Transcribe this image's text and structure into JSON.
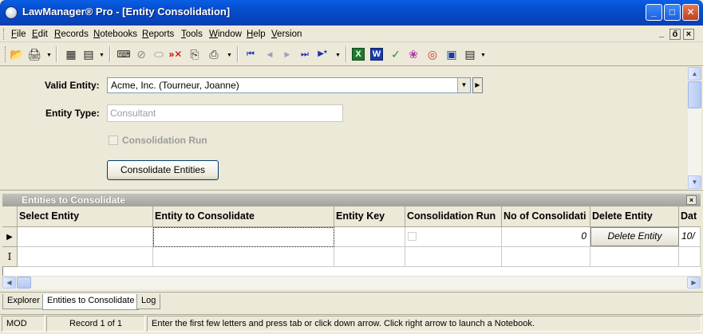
{
  "window": {
    "title": "LawManager® Pro - [Entity Consolidation]",
    "minimize_glyph": "_",
    "maximize_glyph": "□",
    "close_glyph": "✕"
  },
  "menu": {
    "items": [
      "File",
      "Edit",
      "Records",
      "Notebooks",
      "Reports",
      "Tools",
      "Window",
      "Help",
      "Version"
    ],
    "mdi_minimize": "_",
    "mdi_restore": "ő",
    "mdi_close": "×"
  },
  "toolbar": {
    "icons": [
      {
        "name": "open-folder-icon",
        "glyph": "📂"
      },
      {
        "name": "print-icon",
        "glyph": "🖨"
      },
      {
        "name": "window-layout-icon",
        "glyph": "▦"
      },
      {
        "name": "window-tile-icon",
        "glyph": "▤"
      },
      {
        "name": "find-binoculars-icon",
        "glyph": "⌨"
      },
      {
        "name": "cancel-icon",
        "glyph": "⊘"
      },
      {
        "name": "erase-icon",
        "glyph": "⬭"
      },
      {
        "name": "delete-record-icon",
        "glyph": "»✕"
      },
      {
        "name": "copy-record-icon",
        "glyph": "⎘"
      },
      {
        "name": "paste-record-icon",
        "glyph": "⎙"
      },
      {
        "name": "first-record-icon",
        "glyph": "⏮"
      },
      {
        "name": "previous-record-icon",
        "glyph": "◀"
      },
      {
        "name": "next-record-icon",
        "glyph": "▶"
      },
      {
        "name": "last-record-icon",
        "glyph": "⏭"
      },
      {
        "name": "new-record-icon",
        "glyph": "▶*"
      },
      {
        "name": "excel-icon",
        "glyph": "X"
      },
      {
        "name": "word-icon",
        "glyph": "W"
      },
      {
        "name": "spell-check-icon",
        "glyph": "✓"
      },
      {
        "name": "palette-icon",
        "glyph": "❀"
      },
      {
        "name": "help-lifebuoy-icon",
        "glyph": "◎"
      },
      {
        "name": "reports-icon",
        "glyph": "▣"
      },
      {
        "name": "form-view-icon",
        "glyph": "▤"
      }
    ]
  },
  "form": {
    "valid_entity_label": "Valid Entity:",
    "valid_entity_value": "Acme, Inc. (Tourneur, Joanne)",
    "entity_type_label": "Entity Type:",
    "entity_type_value": "Consultant",
    "consolidation_run_label": "Consolidation Run",
    "consolidate_button": "Consolidate Entities"
  },
  "grid": {
    "title": "Entities to Consolidate",
    "columns": [
      "Select Entity",
      "Entity to Consolidate",
      "Entity Key",
      "Consolidation Run",
      "No of Consolidati",
      "Delete Entity",
      "Dat"
    ],
    "rows": [
      {
        "select_entity": "",
        "entity_to_consolidate": "",
        "entity_key": "",
        "no_of_consolidations": "0",
        "delete_label": "Delete Entity",
        "date": "10/"
      }
    ],
    "row_indicators": [
      "▶",
      "I"
    ]
  },
  "tabs": [
    "Explorer",
    "Entities to Consolidate",
    "Log"
  ],
  "tabs_active": 1,
  "status": {
    "mode": "MOD",
    "record": "Record 1 of 1",
    "hint": "Enter the first few letters and press tab or click down arrow. Click right arrow to launch a Notebook."
  }
}
